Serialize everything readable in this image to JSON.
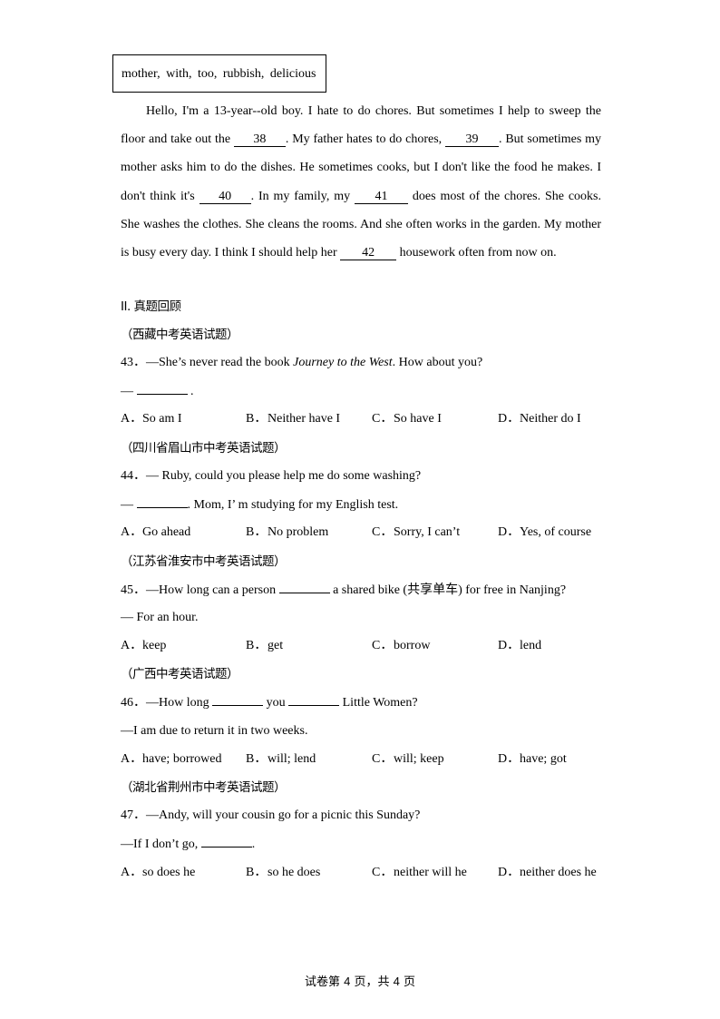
{
  "word_box": {
    "words": "mother,  with,  too,  rubbish,  delicious"
  },
  "passage": {
    "segments": [
      "Hello, I'm a 13-year--old boy. I hate to do chores. But sometimes I help to sweep the floor and take out the ",
      ". My father hates to do chores, ",
      ". But sometimes my mother asks him to do the dishes. He sometimes cooks, but I don't like the food he makes. I don't think it's ",
      ". In my family, my ",
      " does most of the chores. She cooks. She washes the clothes. She cleans the rooms. And she often works in the garden. My mother is busy every day. I think I should help her ",
      " housework often from now on."
    ],
    "blanks": [
      "38",
      "39",
      "40",
      "41",
      "42"
    ]
  },
  "section": {
    "heading": "II.  真题回顾"
  },
  "questions": [
    {
      "source": "（西藏中考英语试题）",
      "number": "43",
      "stem_before": "—She’s never read the book ",
      "stem_italic": "Journey to the West",
      "stem_after": ". How about you?",
      "reply_before": "— ",
      "reply_after": " .",
      "options": [
        {
          "letter": "A．",
          "text": "So am I"
        },
        {
          "letter": "B．",
          "text": "Neither have I"
        },
        {
          "letter": "C．",
          "text": "So have I"
        },
        {
          "letter": "D．",
          "text": "Neither do I"
        }
      ]
    },
    {
      "source": "（四川省眉山市中考英语试题）",
      "number": "44",
      "stem": "— Ruby, could you please help me do some washing?",
      "reply_before": "— ",
      "reply_after": ". Mom, I’ m studying for my English test.",
      "options": [
        {
          "letter": "A．",
          "text": "Go ahead"
        },
        {
          "letter": "B．",
          "text": "No problem"
        },
        {
          "letter": "C．",
          "text": "Sorry, I can’t"
        },
        {
          "letter": "D．",
          "text": "Yes, of course"
        }
      ]
    },
    {
      "source": "（江苏省淮安市中考英语试题）",
      "number": "45",
      "stem_before": "—How long can a person ",
      "stem_after": " a shared bike (共享单车) for free in Nanjing?",
      "reply": "— For an hour.",
      "options": [
        {
          "letter": "A．",
          "text": "keep"
        },
        {
          "letter": "B．",
          "text": "get"
        },
        {
          "letter": "C．",
          "text": "borrow"
        },
        {
          "letter": "D．",
          "text": "lend"
        }
      ]
    },
    {
      "source": "（广西中考英语试题）",
      "number": "46",
      "stem_part1": "—How long ",
      "stem_part2": " you ",
      "stem_part3": " Little Women?",
      "reply": "—I am due to return it in two weeks.",
      "options": [
        {
          "letter": "A．",
          "text": "have; borrowed"
        },
        {
          "letter": "B．",
          "text": "will; lend"
        },
        {
          "letter": "C．",
          "text": "will; keep"
        },
        {
          "letter": "D．",
          "text": "have; got"
        }
      ]
    },
    {
      "source": "（湖北省荆州市中考英语试题）",
      "number": "47",
      "stem": "—Andy, will your cousin go for a picnic this Sunday?",
      "reply_before": "—If I don’t go, ",
      "reply_after": ".",
      "options": [
        {
          "letter": "A．",
          "text": "so does he"
        },
        {
          "letter": "B．",
          "text": "so he does"
        },
        {
          "letter": "C．",
          "text": "neither will he"
        },
        {
          "letter": "D．",
          "text": "neither does he"
        }
      ]
    }
  ],
  "footer": {
    "prefix": "试卷第 ",
    "current_page": "4",
    "middle": " 页，共 ",
    "total_pages": "4",
    "suffix": " 页"
  }
}
